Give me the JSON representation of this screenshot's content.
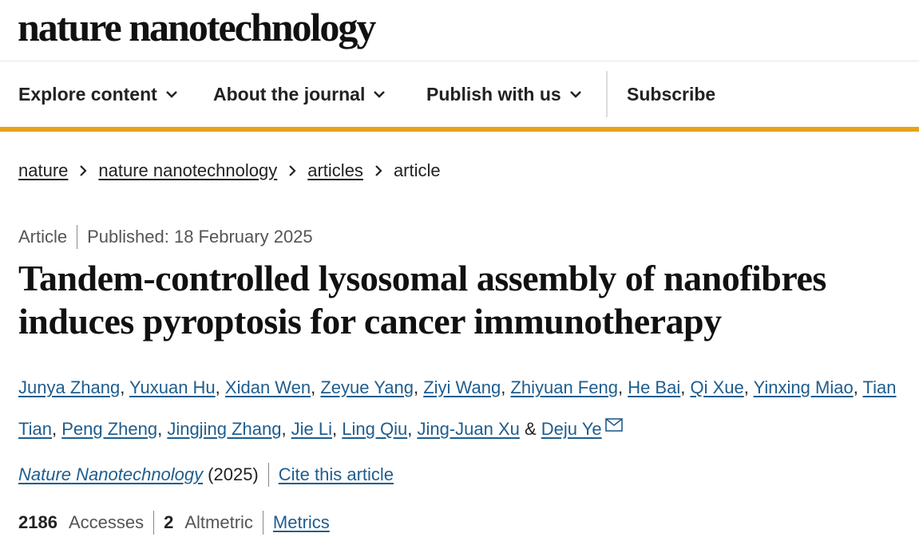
{
  "site": {
    "logo": "nature nanotechnology"
  },
  "nav": {
    "items": [
      {
        "label": "Explore content"
      },
      {
        "label": "About the journal"
      },
      {
        "label": "Publish with us"
      }
    ],
    "subscribe": "Subscribe"
  },
  "breadcrumb": [
    "nature",
    "nature nanotechnology",
    "articles",
    "article"
  ],
  "article": {
    "type": "Article",
    "published": "Published: 18 February 2025",
    "title": "Tandem-controlled lysosomal assembly of nanofibres induces pyroptosis for cancer immunotherapy",
    "authors": [
      "Junya Zhang",
      "Yuxuan Hu",
      "Xidan Wen",
      "Zeyue Yang",
      "Ziyi Wang",
      "Zhiyuan Feng",
      "He Bai",
      "Qi Xue",
      "Yinxing Miao",
      "Tian Tian",
      "Peng Zheng",
      "Jingjing Zhang",
      "Jie Li",
      "Ling Qiu",
      "Jing-Juan Xu",
      "Deju Ye"
    ],
    "author_separator": ",",
    "author_conjunction": "&",
    "journal": "Nature Nanotechnology",
    "year": "(2025)",
    "cite": "Cite this article",
    "accesses_count": "2186",
    "accesses_label": "Accesses",
    "altmetric_count": "2",
    "altmetric_label": "Altmetric",
    "metrics_link": "Metrics"
  },
  "colors": {
    "accent": "#e6a41a",
    "link": "#1f5d8e",
    "text": "#222222"
  },
  "icons": {
    "chevron": "chevron-down-icon",
    "crumb_sep": "chevron-right-icon",
    "mail": "mail-icon"
  }
}
